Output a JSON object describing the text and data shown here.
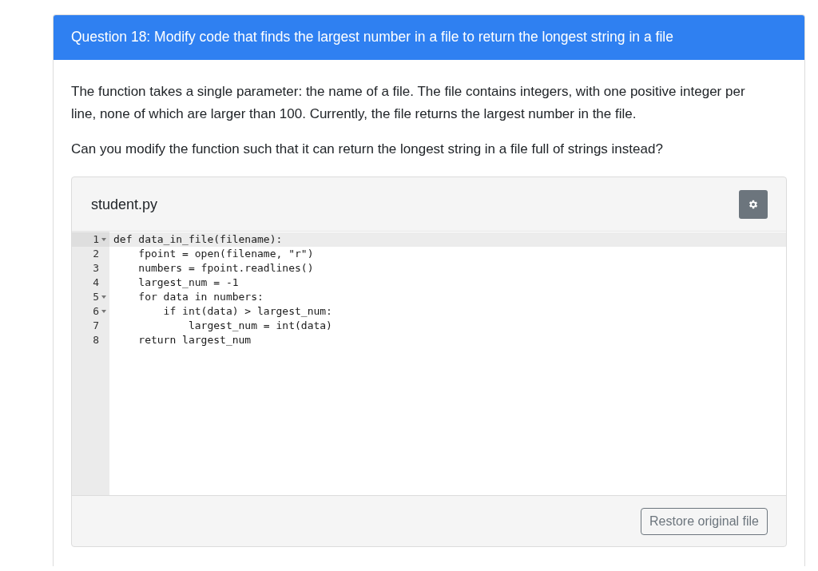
{
  "question": {
    "title": "Question 18: Modify code that finds the largest number in a file to return the longest string in a file",
    "paragraphs": [
      "The function takes a single parameter: the name of a file. The file contains integers, with one positive integer per line, none of which are larger than 100. Currently, the file returns the largest number in the file.",
      "Can you modify the function such that it can return the longest string in a file full of strings instead?"
    ]
  },
  "editor": {
    "filename": "student.py",
    "lines": [
      {
        "number": "1",
        "foldable": true,
        "highlighted": true,
        "text": "def data_in_file(filename):"
      },
      {
        "number": "2",
        "foldable": false,
        "highlighted": false,
        "text": "    fpoint = open(filename, \"r\")"
      },
      {
        "number": "3",
        "foldable": false,
        "highlighted": false,
        "text": "    numbers = fpoint.readlines()"
      },
      {
        "number": "4",
        "foldable": false,
        "highlighted": false,
        "text": "    largest_num = -1"
      },
      {
        "number": "5",
        "foldable": true,
        "highlighted": false,
        "text": "    for data in numbers:"
      },
      {
        "number": "6",
        "foldable": true,
        "highlighted": false,
        "text": "        if int(data) > largest_num:"
      },
      {
        "number": "7",
        "foldable": false,
        "highlighted": false,
        "text": "            largest_num = int(data)"
      },
      {
        "number": "8",
        "foldable": false,
        "highlighted": false,
        "text": "    return largest_num"
      }
    ],
    "restore_button": "Restore original file"
  }
}
